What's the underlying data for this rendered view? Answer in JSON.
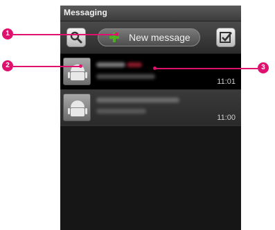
{
  "app": {
    "title": "Messaging"
  },
  "toolbar": {
    "new_message_label": "New message",
    "search_icon": "search-icon",
    "select_icon": "checkbox-icon"
  },
  "conversations": [
    {
      "time": "11:01"
    },
    {
      "time": "11:00"
    }
  ],
  "callouts": [
    "1",
    "2",
    "3"
  ],
  "colors": {
    "callout": "#e0116e",
    "plus": "#4caf1f"
  }
}
